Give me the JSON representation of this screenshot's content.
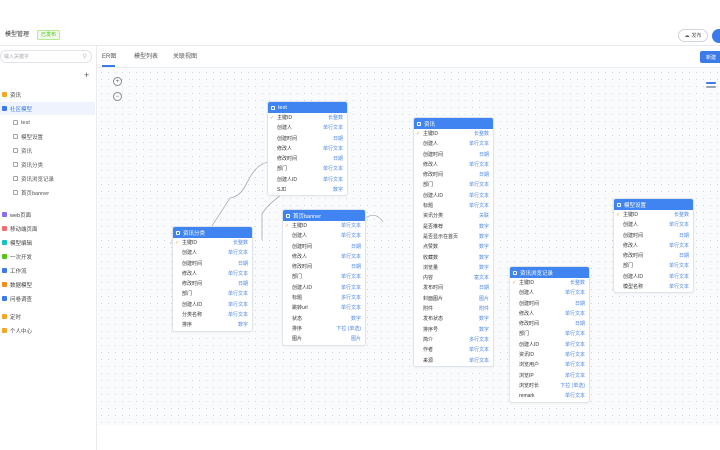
{
  "header": {
    "title": "模型管理",
    "badge": "已发布",
    "top_button_label": "发布"
  },
  "sidebar": {
    "search_placeholder": "输入关键字",
    "items": [
      {
        "label": "资讯",
        "color": "#f5a623",
        "sub": false,
        "active": false
      },
      {
        "label": "社区模型",
        "color": "#3b7ae8",
        "sub": false,
        "active": true
      },
      {
        "label": "test",
        "color": "",
        "sub": true,
        "active": false
      },
      {
        "label": "模型设置",
        "color": "",
        "sub": true,
        "active": false
      },
      {
        "label": "资讯",
        "color": "",
        "sub": true,
        "active": false
      },
      {
        "label": "资讯分类",
        "color": "",
        "sub": true,
        "active": false
      },
      {
        "label": "资讯浏览记录",
        "color": "",
        "sub": true,
        "active": false
      },
      {
        "label": "首页banner",
        "color": "",
        "sub": true,
        "active": false
      },
      {
        "label": "web页面",
        "color": "#8c6cf0",
        "sub": false,
        "active": false
      },
      {
        "label": "移动端页面",
        "color": "#f56c6c",
        "sub": false,
        "active": false
      },
      {
        "label": "模型编辑",
        "color": "#13c2c2",
        "sub": false,
        "active": false
      },
      {
        "label": "一次开发",
        "color": "#52c41a",
        "sub": false,
        "active": false
      },
      {
        "label": "工作流",
        "color": "#3b7ae8",
        "sub": false,
        "active": false
      },
      {
        "label": "数据模型",
        "color": "#fa8c16",
        "sub": false,
        "active": false
      },
      {
        "label": "问卷调查",
        "color": "#3b7ae8",
        "sub": false,
        "active": false
      },
      {
        "label": "定时",
        "color": "#f5a623",
        "sub": false,
        "active": false
      },
      {
        "label": "个人中心",
        "color": "#f5a623",
        "sub": false,
        "active": false
      }
    ]
  },
  "tabs": [
    {
      "label": "ER图",
      "active": true
    },
    {
      "label": "模型列表",
      "active": false
    },
    {
      "label": "关联视图",
      "active": false
    }
  ],
  "canvas": {
    "add_button_label": "新建",
    "zoom_in_label": "+",
    "zoom_out_label": "−"
  },
  "entities": [
    {
      "name": "test",
      "fields": [
        {
          "name": "主键ID",
          "type": "长整数",
          "pk": true
        },
        {
          "name": "创建人",
          "type": "单行文本",
          "pk": false
        },
        {
          "name": "创建时间",
          "type": "日期",
          "pk": false
        },
        {
          "name": "修改人",
          "type": "单行文本",
          "pk": false
        },
        {
          "name": "修改时间",
          "type": "日期",
          "pk": false
        },
        {
          "name": "部门",
          "type": "单行文本",
          "pk": false
        },
        {
          "name": "创建人ID",
          "type": "单行文本",
          "pk": false
        },
        {
          "name": "SJD",
          "type": "数字",
          "pk": false
        }
      ]
    },
    {
      "name": "资讯分类",
      "fields": [
        {
          "name": "主键ID",
          "type": "长整数",
          "pk": true
        },
        {
          "name": "创建人",
          "type": "单行文本",
          "pk": false
        },
        {
          "name": "创建时间",
          "type": "日期",
          "pk": false
        },
        {
          "name": "修改人",
          "type": "单行文本",
          "pk": false
        },
        {
          "name": "修改时间",
          "type": "日期",
          "pk": false
        },
        {
          "name": "部门",
          "type": "单行文本",
          "pk": false
        },
        {
          "name": "创建人ID",
          "type": "单行文本",
          "pk": false
        },
        {
          "name": "分类名称",
          "type": "单行文本",
          "pk": false
        },
        {
          "name": "排序",
          "type": "数字",
          "pk": false
        }
      ]
    },
    {
      "name": "首页banner",
      "fields": [
        {
          "name": "主键ID",
          "type": "单行文本",
          "pk": true
        },
        {
          "name": "创建人",
          "type": "单行文本",
          "pk": false
        },
        {
          "name": "创建时间",
          "type": "日期",
          "pk": false
        },
        {
          "name": "修改人",
          "type": "单行文本",
          "pk": false
        },
        {
          "name": "修改时间",
          "type": "日期",
          "pk": false
        },
        {
          "name": "部门",
          "type": "单行文本",
          "pk": false
        },
        {
          "name": "创建人ID",
          "type": "单行文本",
          "pk": false
        },
        {
          "name": "标题",
          "type": "多行文本",
          "pk": false
        },
        {
          "name": "跳转url",
          "type": "单行文本",
          "pk": false
        },
        {
          "name": "状态",
          "type": "数字",
          "pk": false
        },
        {
          "name": "排序",
          "type": "下拉 (单选)",
          "pk": false
        },
        {
          "name": "图片",
          "type": "图片",
          "pk": false
        }
      ]
    },
    {
      "name": "资讯",
      "fields": [
        {
          "name": "主键ID",
          "type": "长整数",
          "pk": true
        },
        {
          "name": "创建人",
          "type": "单行文本",
          "pk": false
        },
        {
          "name": "创建时间",
          "type": "日期",
          "pk": false
        },
        {
          "name": "修改人",
          "type": "单行文本",
          "pk": false
        },
        {
          "name": "修改时间",
          "type": "日期",
          "pk": false
        },
        {
          "name": "部门",
          "type": "单行文本",
          "pk": false
        },
        {
          "name": "创建人ID",
          "type": "单行文本",
          "pk": false
        },
        {
          "name": "标题",
          "type": "单行文本",
          "pk": false
        },
        {
          "name": "资讯分类",
          "type": "关联",
          "pk": false
        },
        {
          "name": "是否推荐",
          "type": "数字",
          "pk": false
        },
        {
          "name": "是否显示在首页",
          "type": "数字",
          "pk": false
        },
        {
          "name": "点赞数",
          "type": "数字",
          "pk": false
        },
        {
          "name": "收藏数",
          "type": "数字",
          "pk": false
        },
        {
          "name": "浏览量",
          "type": "数字",
          "pk": false
        },
        {
          "name": "内容",
          "type": "富文本",
          "pk": false
        },
        {
          "name": "发布时间",
          "type": "日期",
          "pk": false
        },
        {
          "name": "封面图片",
          "type": "图片",
          "pk": false
        },
        {
          "name": "附件",
          "type": "附件",
          "pk": false
        },
        {
          "name": "发布状态",
          "type": "数字",
          "pk": false
        },
        {
          "name": "排序号",
          "type": "数字",
          "pk": false
        },
        {
          "name": "简介",
          "type": "多行文本",
          "pk": false
        },
        {
          "name": "作者",
          "type": "单行文本",
          "pk": false
        },
        {
          "name": "来源",
          "type": "单行文本",
          "pk": false
        }
      ]
    },
    {
      "name": "资讯浏览记录",
      "fields": [
        {
          "name": "主键ID",
          "type": "长整数",
          "pk": true
        },
        {
          "name": "创建人",
          "type": "单行文本",
          "pk": false
        },
        {
          "name": "创建时间",
          "type": "日期",
          "pk": false
        },
        {
          "name": "修改人",
          "type": "单行文本",
          "pk": false
        },
        {
          "name": "修改时间",
          "type": "日期",
          "pk": false
        },
        {
          "name": "部门",
          "type": "单行文本",
          "pk": false
        },
        {
          "name": "创建人ID",
          "type": "单行文本",
          "pk": false
        },
        {
          "name": "资讯ID",
          "type": "单行文本",
          "pk": false
        },
        {
          "name": "浏览用户",
          "type": "单行文本",
          "pk": false
        },
        {
          "name": "浏览IP",
          "type": "单行文本",
          "pk": false
        },
        {
          "name": "浏览时长",
          "type": "下拉 (单选)",
          "pk": false
        },
        {
          "name": "remark",
          "type": "单行文本",
          "pk": false
        }
      ]
    },
    {
      "name": "模型设置",
      "fields": [
        {
          "name": "主键ID",
          "type": "长整数",
          "pk": true
        },
        {
          "name": "创建人",
          "type": "单行文本",
          "pk": false
        },
        {
          "name": "创建时间",
          "type": "日期",
          "pk": false
        },
        {
          "name": "修改人",
          "type": "单行文本",
          "pk": false
        },
        {
          "name": "修改时间",
          "type": "日期",
          "pk": false
        },
        {
          "name": "部门",
          "type": "单行文本",
          "pk": false
        },
        {
          "name": "创建人ID",
          "type": "单行文本",
          "pk": false
        },
        {
          "name": "模型名称",
          "type": "单行文本",
          "pk": false
        }
      ]
    }
  ]
}
